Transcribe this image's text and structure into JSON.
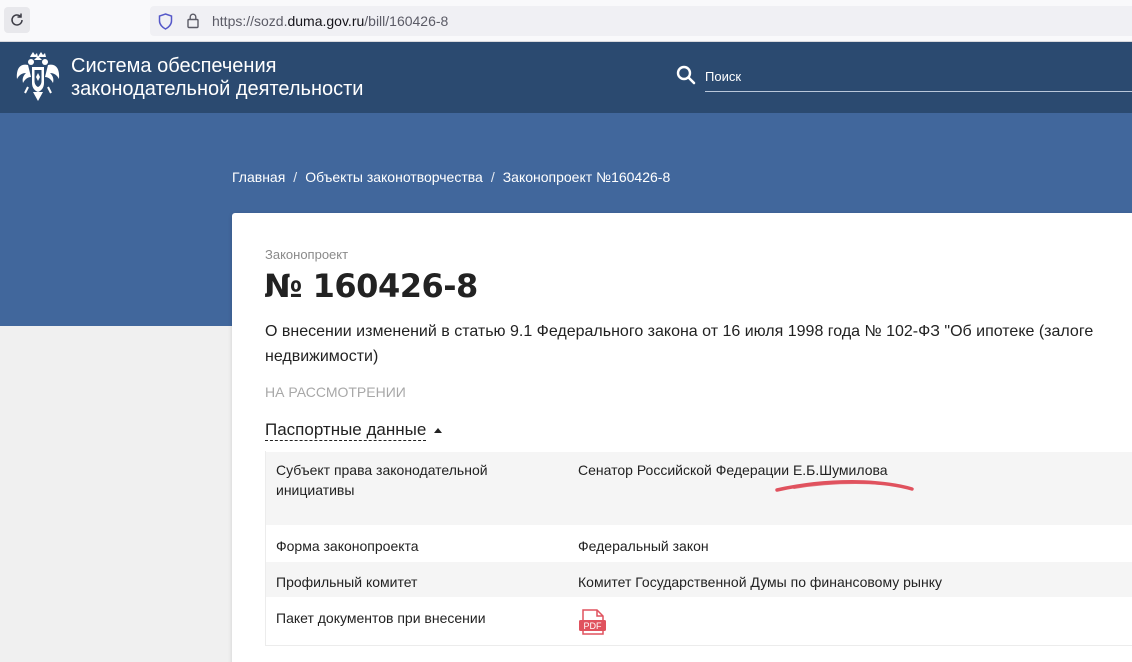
{
  "browser": {
    "url_prefix": "https://sozd.",
    "url_domain": "duma.gov.ru",
    "url_path": "/bill/160426-8"
  },
  "header": {
    "site_title": "Система обеспечения\nзаконодательной деятельности",
    "search_placeholder": "Поиск"
  },
  "breadcrumb": {
    "items": [
      "Главная",
      "Объекты законотворчества",
      "Законопроект №160426-8"
    ],
    "separator": "/"
  },
  "bill": {
    "type_label": "Законопроект",
    "number": "№ 160426-8",
    "title": "О внесении изменений в статью 9.1 Федерального закона от 16 июля 1998 года № 102-ФЗ \"Об ипотеке (залоге недвижимости)",
    "status": "НА РАССМОТРЕНИИ"
  },
  "passport": {
    "toggle_label": "Паспортные данные",
    "rows": [
      {
        "key": "Субъект права законодательной инициативы",
        "value": "Сенатор Российской Федерации Е.Б.Шумилова"
      },
      {
        "key": "Форма законопроекта",
        "value": "Федеральный закон"
      },
      {
        "key": "Профильный комитет",
        "value": "Комитет Государственной Думы по финансовому рынку"
      },
      {
        "key": "Пакет документов при внесении",
        "value": "",
        "icon": "pdf-icon",
        "icon_text": "PDF"
      }
    ]
  },
  "colors": {
    "header_bg": "#2b4a70",
    "hero_bg": "#41679c",
    "annotation": "#e0525e",
    "pdf": "#e0525e"
  }
}
